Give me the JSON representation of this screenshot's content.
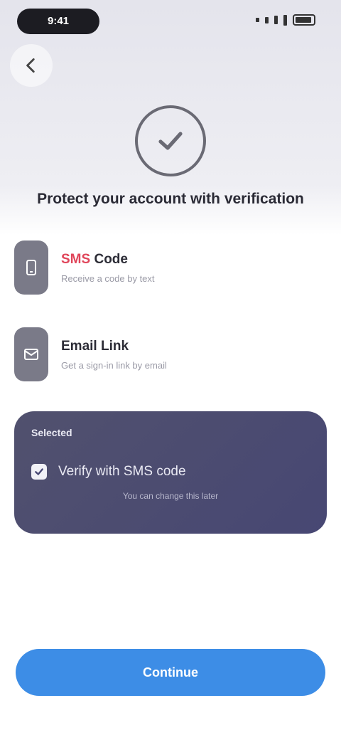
{
  "status_bar": {
    "time": "9:41"
  },
  "header": {
    "back_icon": "chevron-left-icon"
  },
  "hero": {
    "icon": "checkmark-circle-icon",
    "headline": "Protect your account with verification"
  },
  "features": [
    {
      "icon": "phone-icon",
      "title_accent": "SMS",
      "title_rest": " Code",
      "subtitle": "Receive a code by text"
    },
    {
      "icon": "mail-icon",
      "title_accent": "",
      "title_rest": "Email Link",
      "subtitle": "Get a sign-in link by email"
    }
  ],
  "card": {
    "label": "Selected",
    "option": "Verify with SMS code",
    "note": "You can change this later"
  },
  "cta": {
    "label": "Continue"
  },
  "colors": {
    "accent": "#3d8de6",
    "card": "#4a4a70",
    "highlight": "#e0455a"
  }
}
